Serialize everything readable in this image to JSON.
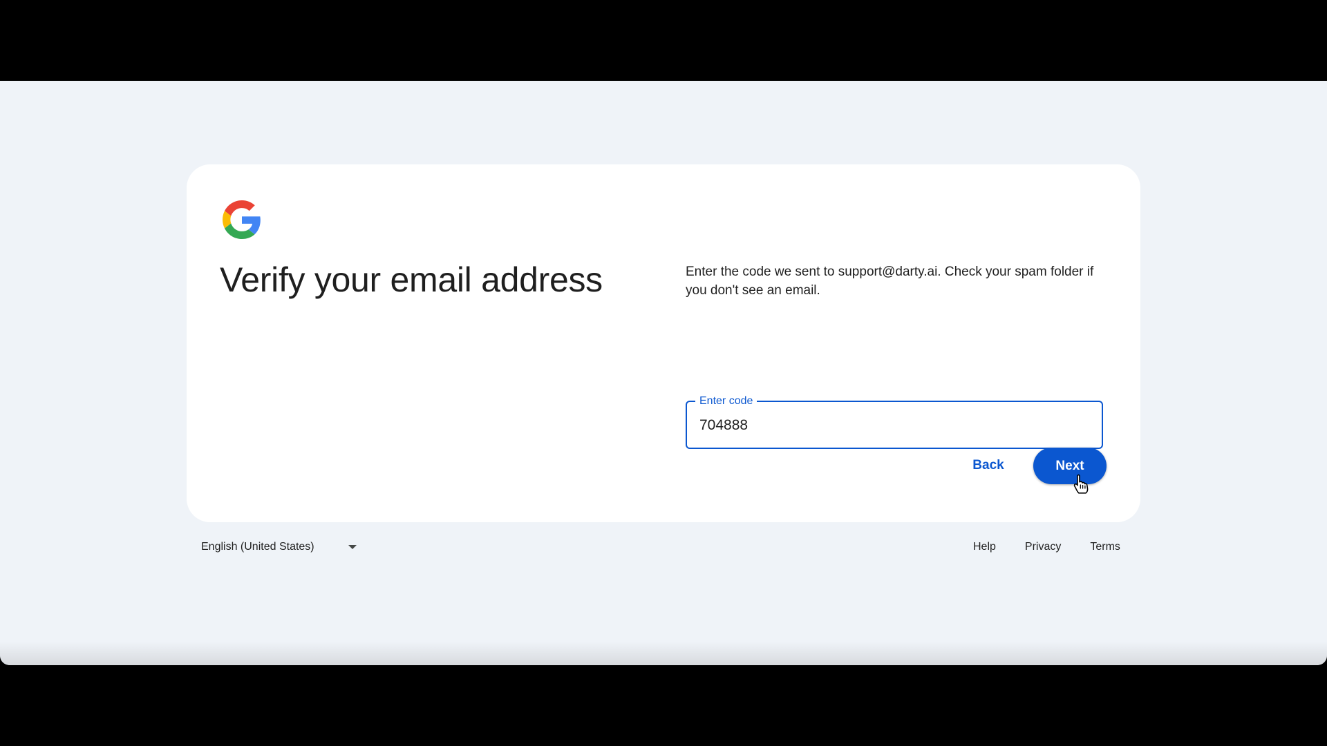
{
  "page": {
    "title": "Verify your email address",
    "description": "Enter the code we sent to support@darty.ai. Check your spam folder if you don't see an email."
  },
  "logo": {
    "icon": "google-g-logo"
  },
  "code_field": {
    "label": "Enter code",
    "value": "704888"
  },
  "actions": {
    "back_label": "Back",
    "next_label": "Next"
  },
  "footer": {
    "language": "English (United States)",
    "links": {
      "help": "Help",
      "privacy": "Privacy",
      "terms": "Terms"
    }
  },
  "colors": {
    "accent": "#0b57d0",
    "background": "#eff3f8",
    "card": "#ffffff",
    "text": "#1f1f1f"
  },
  "icons": {
    "cursor": "hand-pointer-icon",
    "dropdown": "caret-down-icon"
  }
}
